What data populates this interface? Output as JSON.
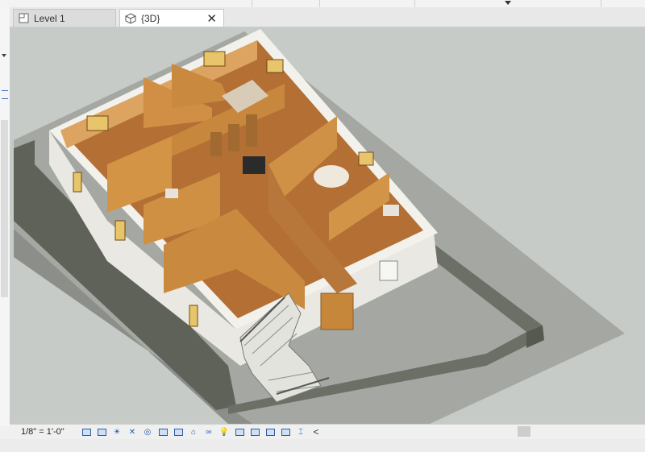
{
  "tabs": [
    {
      "label": "Level 1",
      "icon": "floor-plan-icon",
      "active": false
    },
    {
      "label": "{3D}",
      "icon": "3d-view-icon",
      "active": true,
      "close": "✕"
    }
  ],
  "status_bar": {
    "scale": "1/8\" = 1'-0\"",
    "controls": [
      "detail-level-icon",
      "visual-style-icon",
      "sun-path-icon",
      "shadows-icon",
      "render-icon",
      "crop-view-icon",
      "show-crop-region-icon",
      "unlock-3d-view-icon",
      "temporary-hide-icon",
      "reveal-hidden-icon",
      "temporary-view-properties-icon",
      "worksharing-display-icon",
      "analytical-model-icon",
      "highlight-displacement-icon",
      "constraints-icon"
    ],
    "scroll_left": "<"
  },
  "colors": {
    "ground": "#c7cbc8",
    "slab": "#9ea19b",
    "wall_exterior": "#ecebe6",
    "interior_wood": "#c88a3e",
    "floor_wood": "#9a5a2a"
  }
}
